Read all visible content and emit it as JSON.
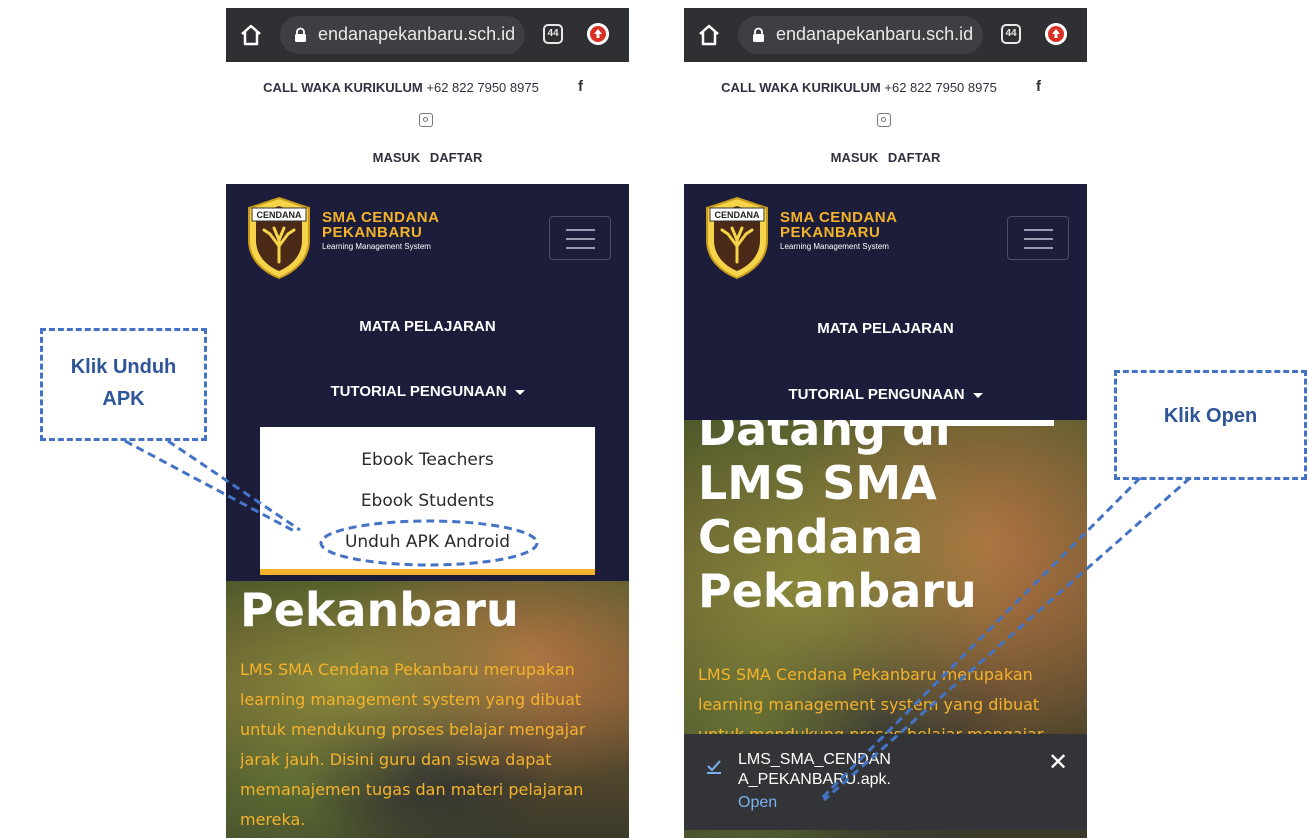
{
  "browser": {
    "url": "endanapekanbaru.sch.id",
    "tab_count": "44"
  },
  "site": {
    "call_label": "CALL WAKA KURIKULUM",
    "call_number": "+62 822 7950 8975",
    "social_facebook": "f",
    "login": "MASUK",
    "register": "DAFTAR",
    "logo_badge": "CENDANA",
    "brand_line1": "SMA CENDANA",
    "brand_line2": "PEKANBARU",
    "brand_sub": "Learning Management System",
    "nav_subjects": "MATA PELAJARAN",
    "nav_tutorial": "TUTORIAL PENGUNAAN",
    "accent_color": "#f5b32b",
    "navy_color": "#1c1d3a"
  },
  "dropdown": {
    "items": [
      "Ebook Teachers",
      "Ebook Students",
      "Unduh APK Android"
    ]
  },
  "hero": {
    "heading_lines": [
      "Datang di",
      "LMS SMA",
      "Cendana",
      "Pekanbaru"
    ],
    "description_lines_left": [
      "LMS SMA Cendana Pekanbaru merupakan",
      "learning management system yang dibuat",
      "untuk mendukung proses belajar mengajar",
      "jarak jauh. Disini guru dan siswa dapat",
      "memanajemen tugas dan materi pelajaran",
      "mereka."
    ],
    "description_lines_right": [
      "LMS SMA Cendana Pekanbaru merupakan",
      "learning management system yang dibuat",
      "untuk mendukung proses belajar mengajar"
    ]
  },
  "download": {
    "filename_line1": "LMS_SMA_CENDAN",
    "filename_line2": "A_PEKANBARU.apk.",
    "open_label": "Open",
    "close_label": "✕"
  },
  "annotations": {
    "left_callout": [
      "Klik Unduh",
      "APK"
    ],
    "right_callout": "Klik Open",
    "callout_color": "#4473c5"
  }
}
